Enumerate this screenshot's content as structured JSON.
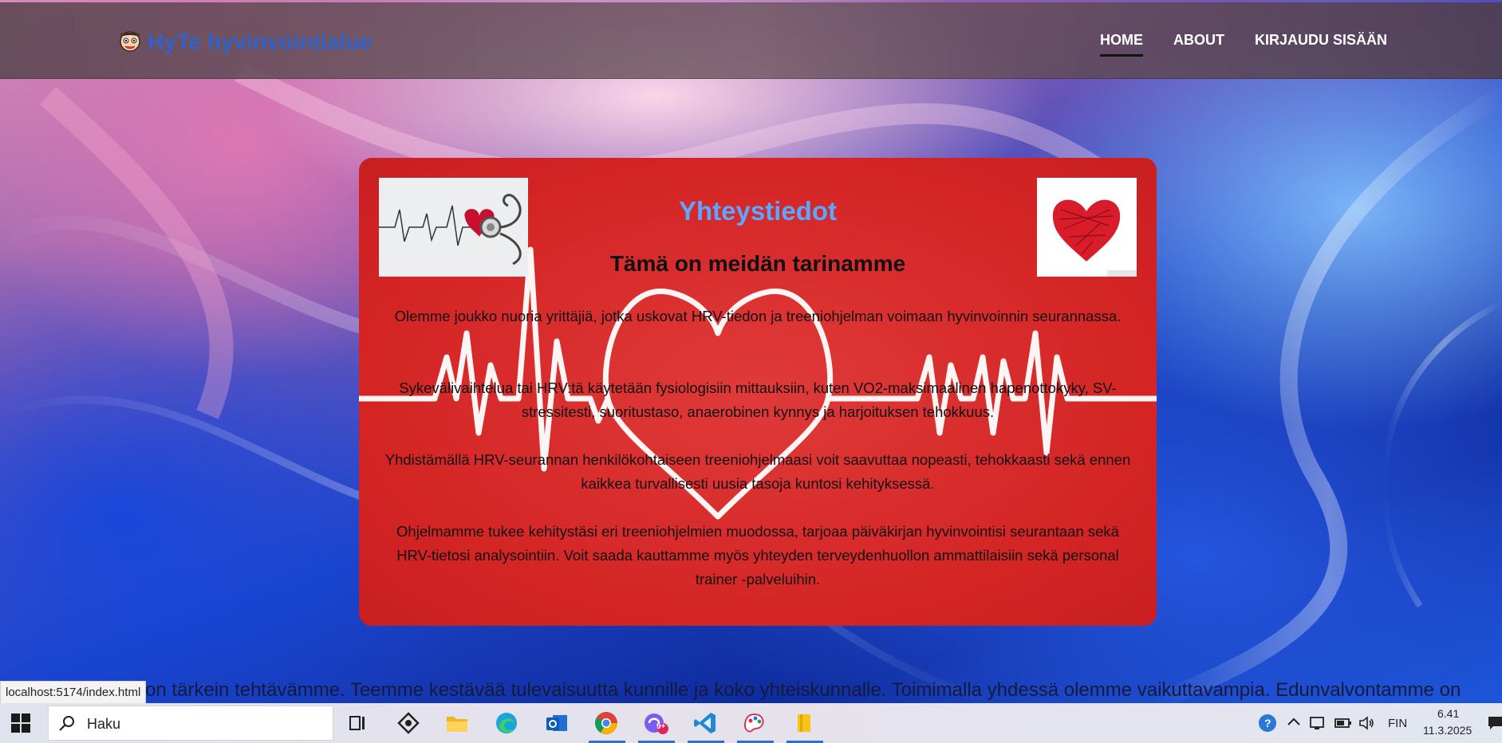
{
  "brand": {
    "name": "HyTe hyvinvointialue",
    "logo_icon": "cartoon-face-icon"
  },
  "nav": {
    "items": [
      {
        "label": "HOME",
        "active": true
      },
      {
        "label": "ABOUT",
        "active": false
      },
      {
        "label": "KIRJAUDU SISÄÄN",
        "active": false
      }
    ]
  },
  "card": {
    "title": "Yhteystiedot",
    "subtitle": "Tämä on meidän tarinamme",
    "paragraphs": [
      "Olemme joukko nuoria yrittäjiä, jotka uskovat HRV-tiedon ja treeniohjelman voimaan hyvinvoinnin seurannassa.",
      "Sykevälivaihtelua tai HRV:tä käytetään fysiologisiin mittauksiin, kuten VO2-maksimaalinen hapenottokyky, SV-stressitesti, suoritustaso, anaerobinen kynnys ja harjoituksen tehokkuus.",
      "Yhdistämällä HRV-seurannan henkilökohtaiseen treeniohjelmaasi voit saavuttaa nopeasti, tehokkaasti sekä ennen kaikkea turvallisesti uusia tasoja kuntosi kehityksessä.",
      "Ohjelmamme tukee kehitystäsi eri treeniohjelmien muodossa, tarjoaa päiväkirjan hyvinvointisi seurantaan sekä HRV-tietosi analysointiin. Voit saada kauttamme myös yhteyden terveydenhuollon ammattilaisiin sekä personal trainer -palveluihin."
    ],
    "left_image_icon": "heartbeat-stethoscope-image",
    "right_image_icon": "scribbled-heart-image",
    "background_icon": "ecg-heart-line-icon",
    "color": "#d62828",
    "title_color": "#5aa7ff"
  },
  "marquee_text": "on tärkein tehtävämme. Teemme kestävää tulevaisuutta kunnille ja koko yhteiskunnalle. Toimimalla yhdessä olemme vaikuttavampia. Edunvalvontamme on",
  "status_url": "localhost:5174/index.html",
  "taskbar": {
    "search_placeholder": "Haku",
    "apps": [
      "task-view-icon",
      "copilot-icon",
      "file-explorer-icon",
      "edge-icon",
      "outlook-icon",
      "chrome-icon",
      "badge-app-icon",
      "vscode-icon",
      "paint-icon",
      "notes-icon"
    ],
    "badge_count": "9+",
    "language": "FIN",
    "time": "6.41",
    "date": "11.3.2025"
  }
}
